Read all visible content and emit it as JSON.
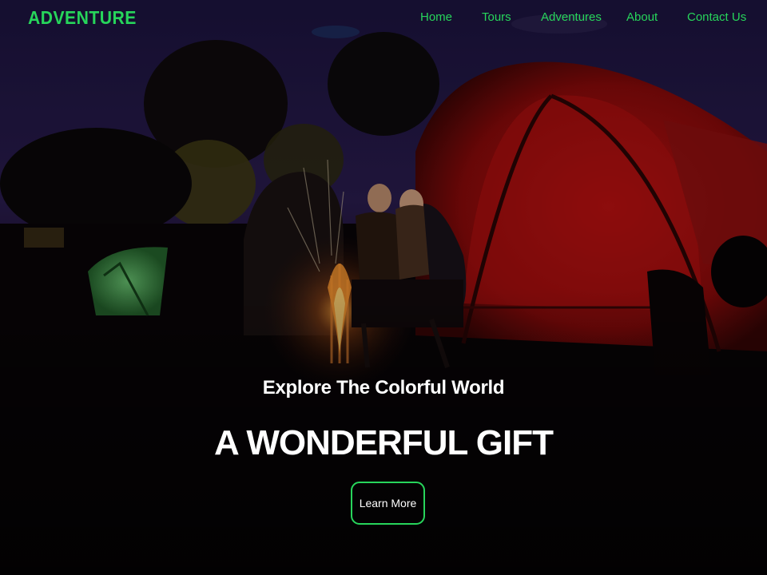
{
  "brand": {
    "name": "ADVENTURE"
  },
  "nav": {
    "items": [
      {
        "label": "Home"
      },
      {
        "label": "Tours"
      },
      {
        "label": "Adventures"
      },
      {
        "label": "About"
      },
      {
        "label": "Contact Us"
      }
    ]
  },
  "hero": {
    "subtitle": "Explore The Colorful World",
    "title": "A WONDERFUL GIFT",
    "cta_label": "Learn More",
    "background_image": "night-camping-scene"
  },
  "colors": {
    "accent": "#27d55b",
    "hero_text": "#ffffff",
    "tent_red": "#a50e0e",
    "tent_green": "#4fbf5c",
    "sky": "#2a1a4a"
  }
}
